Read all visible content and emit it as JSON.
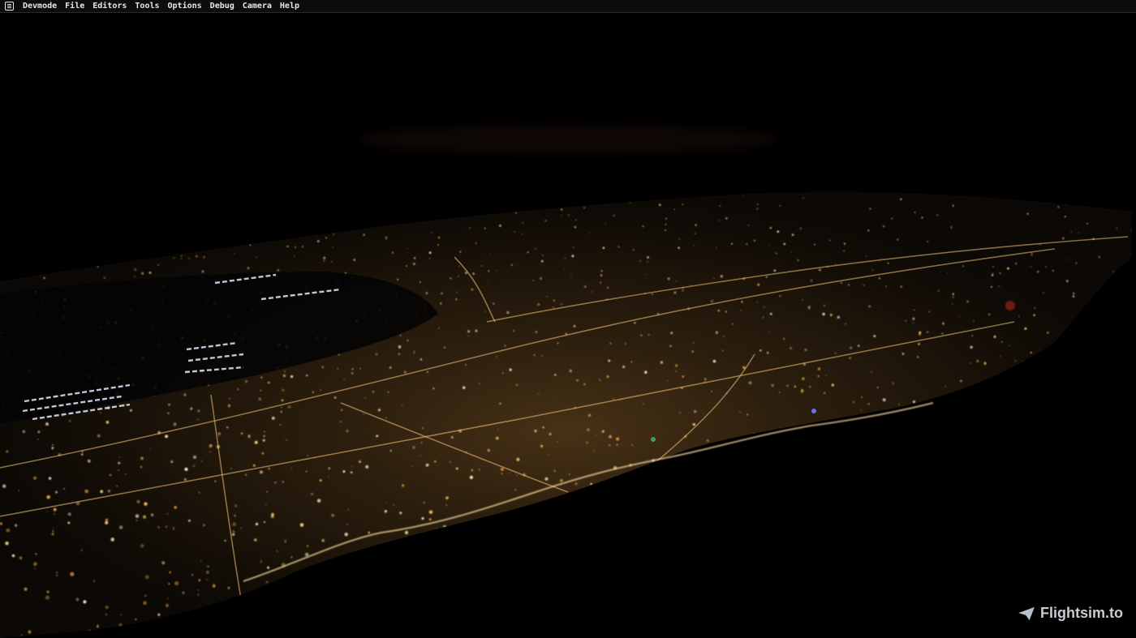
{
  "menubar": {
    "app_icon": "devmode-app-icon",
    "items": [
      {
        "label": "Devmode"
      },
      {
        "label": "File"
      },
      {
        "label": "Editors"
      },
      {
        "label": "Tools"
      },
      {
        "label": "Options"
      },
      {
        "label": "Debug"
      },
      {
        "label": "Camera"
      },
      {
        "label": "Help"
      }
    ]
  },
  "scene": {
    "description_type": "night-aerial-city-lights",
    "colors": {
      "sky": "#000000",
      "city_light": "#e8b060",
      "city_glow": "#6a4a20",
      "runway_light": "#cfe3ff",
      "water": "#030406"
    }
  },
  "watermark": {
    "icon": "paper-plane-icon",
    "text": "Flightsim.to"
  }
}
